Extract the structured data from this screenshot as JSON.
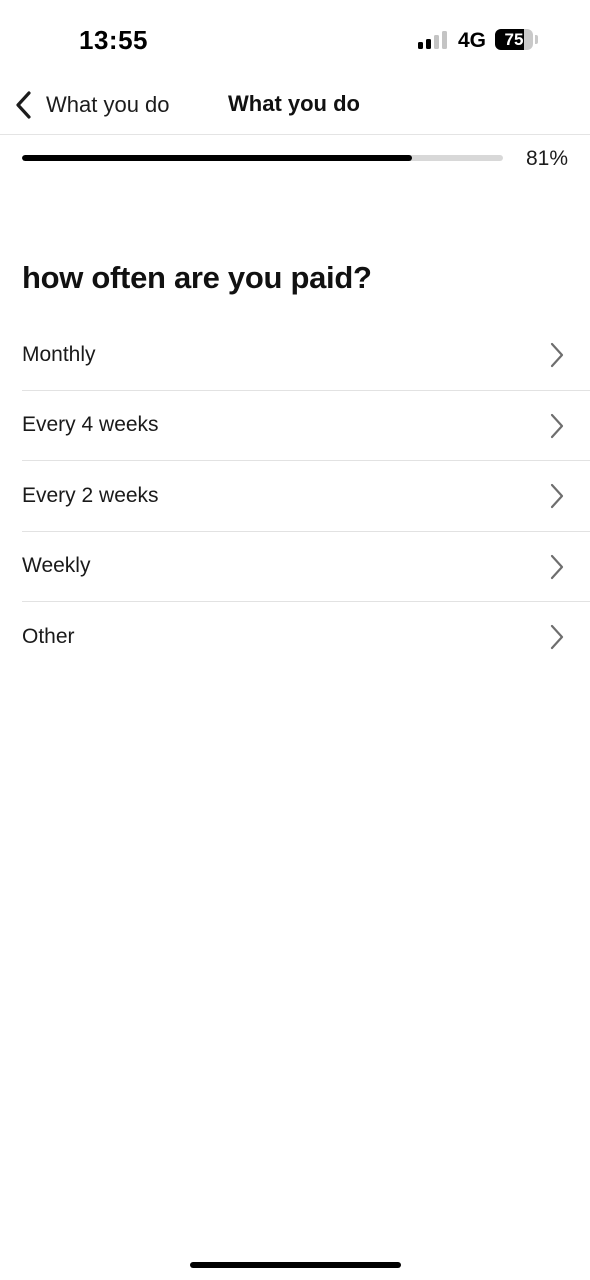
{
  "status_bar": {
    "time": "13:55",
    "network": "4G",
    "battery": "75"
  },
  "nav": {
    "back_label": "What you do",
    "title": "What you do"
  },
  "progress": {
    "value": 81,
    "label": "81%"
  },
  "question": "how often are you paid?",
  "options": [
    {
      "label": "Monthly"
    },
    {
      "label": "Every 4 weeks"
    },
    {
      "label": "Every 2 weeks"
    },
    {
      "label": "Weekly"
    },
    {
      "label": "Other"
    }
  ],
  "colors": {
    "text": "#111111",
    "progress_fill": "#000000",
    "progress_track": "#d8d8d8",
    "chevron": "#6e6e6e",
    "divider": "#e2e2e2"
  }
}
